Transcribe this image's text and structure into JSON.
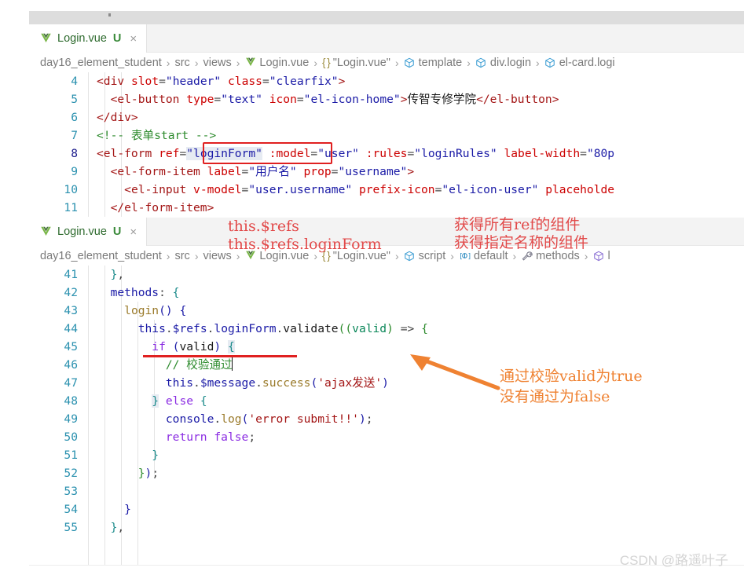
{
  "window": {
    "chrome_label": ""
  },
  "panels": [
    {
      "id": "top-editor",
      "tab": {
        "icon": "vue-icon",
        "filename": "Login.vue",
        "badge": "U",
        "close": "×"
      },
      "breadcrumb": [
        {
          "label": "day16_element_student",
          "icon": ""
        },
        {
          "label": "src",
          "icon": ""
        },
        {
          "label": "views",
          "icon": ""
        },
        {
          "label": "Login.vue",
          "icon": "vue-icon"
        },
        {
          "label": "\"Login.vue\"",
          "icon": "braces-icon"
        },
        {
          "label": "template",
          "icon": "cube-icon"
        },
        {
          "label": "div.login",
          "icon": "cube-icon"
        },
        {
          "label": "el-card.logi",
          "icon": "cube-icon"
        }
      ],
      "lines": [
        {
          "num": "4",
          "active": false,
          "text": "<div slot=\"header\" class=\"clearfix\">"
        },
        {
          "num": "5",
          "active": false,
          "text": "  <el-button type=\"text\" icon=\"el-icon-home\">传智专修学院</el-button>"
        },
        {
          "num": "6",
          "active": false,
          "text": "</div>"
        },
        {
          "num": "7",
          "active": false,
          "text": "<!-- 表单start -->"
        },
        {
          "num": "8",
          "active": true,
          "text": "<el-form ref=\"loginForm\" :model=\"user\" :rules=\"loginRules\" label-width=\"80p"
        },
        {
          "num": "9",
          "active": false,
          "text": "  <el-form-item label=\"用户名\" prop=\"username\">"
        },
        {
          "num": "10",
          "active": false,
          "text": "    <el-input v-model=\"user.username\" prefix-icon=\"el-icon-user\" placeholde"
        },
        {
          "num": "11",
          "active": false,
          "text": "  </el-form-item>"
        }
      ]
    },
    {
      "id": "bottom-editor",
      "tab": {
        "icon": "vue-icon",
        "filename": "Login.vue",
        "badge": "U",
        "close": "×"
      },
      "breadcrumb": [
        {
          "label": "day16_element_student",
          "icon": ""
        },
        {
          "label": "src",
          "icon": ""
        },
        {
          "label": "views",
          "icon": ""
        },
        {
          "label": "Login.vue",
          "icon": "vue-icon"
        },
        {
          "label": "\"Login.vue\"",
          "icon": "braces-icon"
        },
        {
          "label": "script",
          "icon": "cube-icon"
        },
        {
          "label": "default",
          "icon": "export-icon"
        },
        {
          "label": "methods",
          "icon": "wrench-icon"
        },
        {
          "label": "l",
          "icon": "cube-purple-icon"
        }
      ],
      "lines": [
        {
          "num": "41",
          "active": false,
          "text": "  },"
        },
        {
          "num": "42",
          "active": false,
          "text": "  methods: {"
        },
        {
          "num": "43",
          "active": false,
          "text": "    login() {"
        },
        {
          "num": "44",
          "active": false,
          "text": "      this.$refs.loginForm.validate((valid) => {"
        },
        {
          "num": "45",
          "active": false,
          "text": "        if (valid) {"
        },
        {
          "num": "46",
          "active": true,
          "text": "          // 校验通过"
        },
        {
          "num": "47",
          "active": false,
          "text": "          this.$message.success('ajax发送')"
        },
        {
          "num": "48",
          "active": false,
          "text": "        } else {"
        },
        {
          "num": "49",
          "active": false,
          "text": "          console.log('error submit!!');"
        },
        {
          "num": "50",
          "active": false,
          "text": "          return false;"
        },
        {
          "num": "51",
          "active": false,
          "text": "        }"
        },
        {
          "num": "52",
          "active": false,
          "text": "      });"
        },
        {
          "num": "53",
          "active": false,
          "text": ""
        },
        {
          "num": "54",
          "active": false,
          "text": "    }"
        },
        {
          "num": "55",
          "active": false,
          "text": "  },"
        }
      ]
    }
  ],
  "annotations": {
    "red_box_target": "ref=\"loginForm\"",
    "red_code_line1": "this.$refs",
    "red_code_line2": "this.$refs.loginForm",
    "red_note_line1": "获得所有ref的组件",
    "red_note_line2": "获得指定名称的组件",
    "orange_note_line1": "通过校验valid为true",
    "orange_note_line2": "没有通过为false",
    "underline_target": "this.$refs.loginForm"
  },
  "colors": {
    "red_accent": "#e02020",
    "red_text": "#e24a4a",
    "orange_accent": "#ef8232",
    "vue_green": "#41b883",
    "breadcrumb_gray": "#7a7a7a"
  },
  "watermark": "CSDN @路遥叶子"
}
